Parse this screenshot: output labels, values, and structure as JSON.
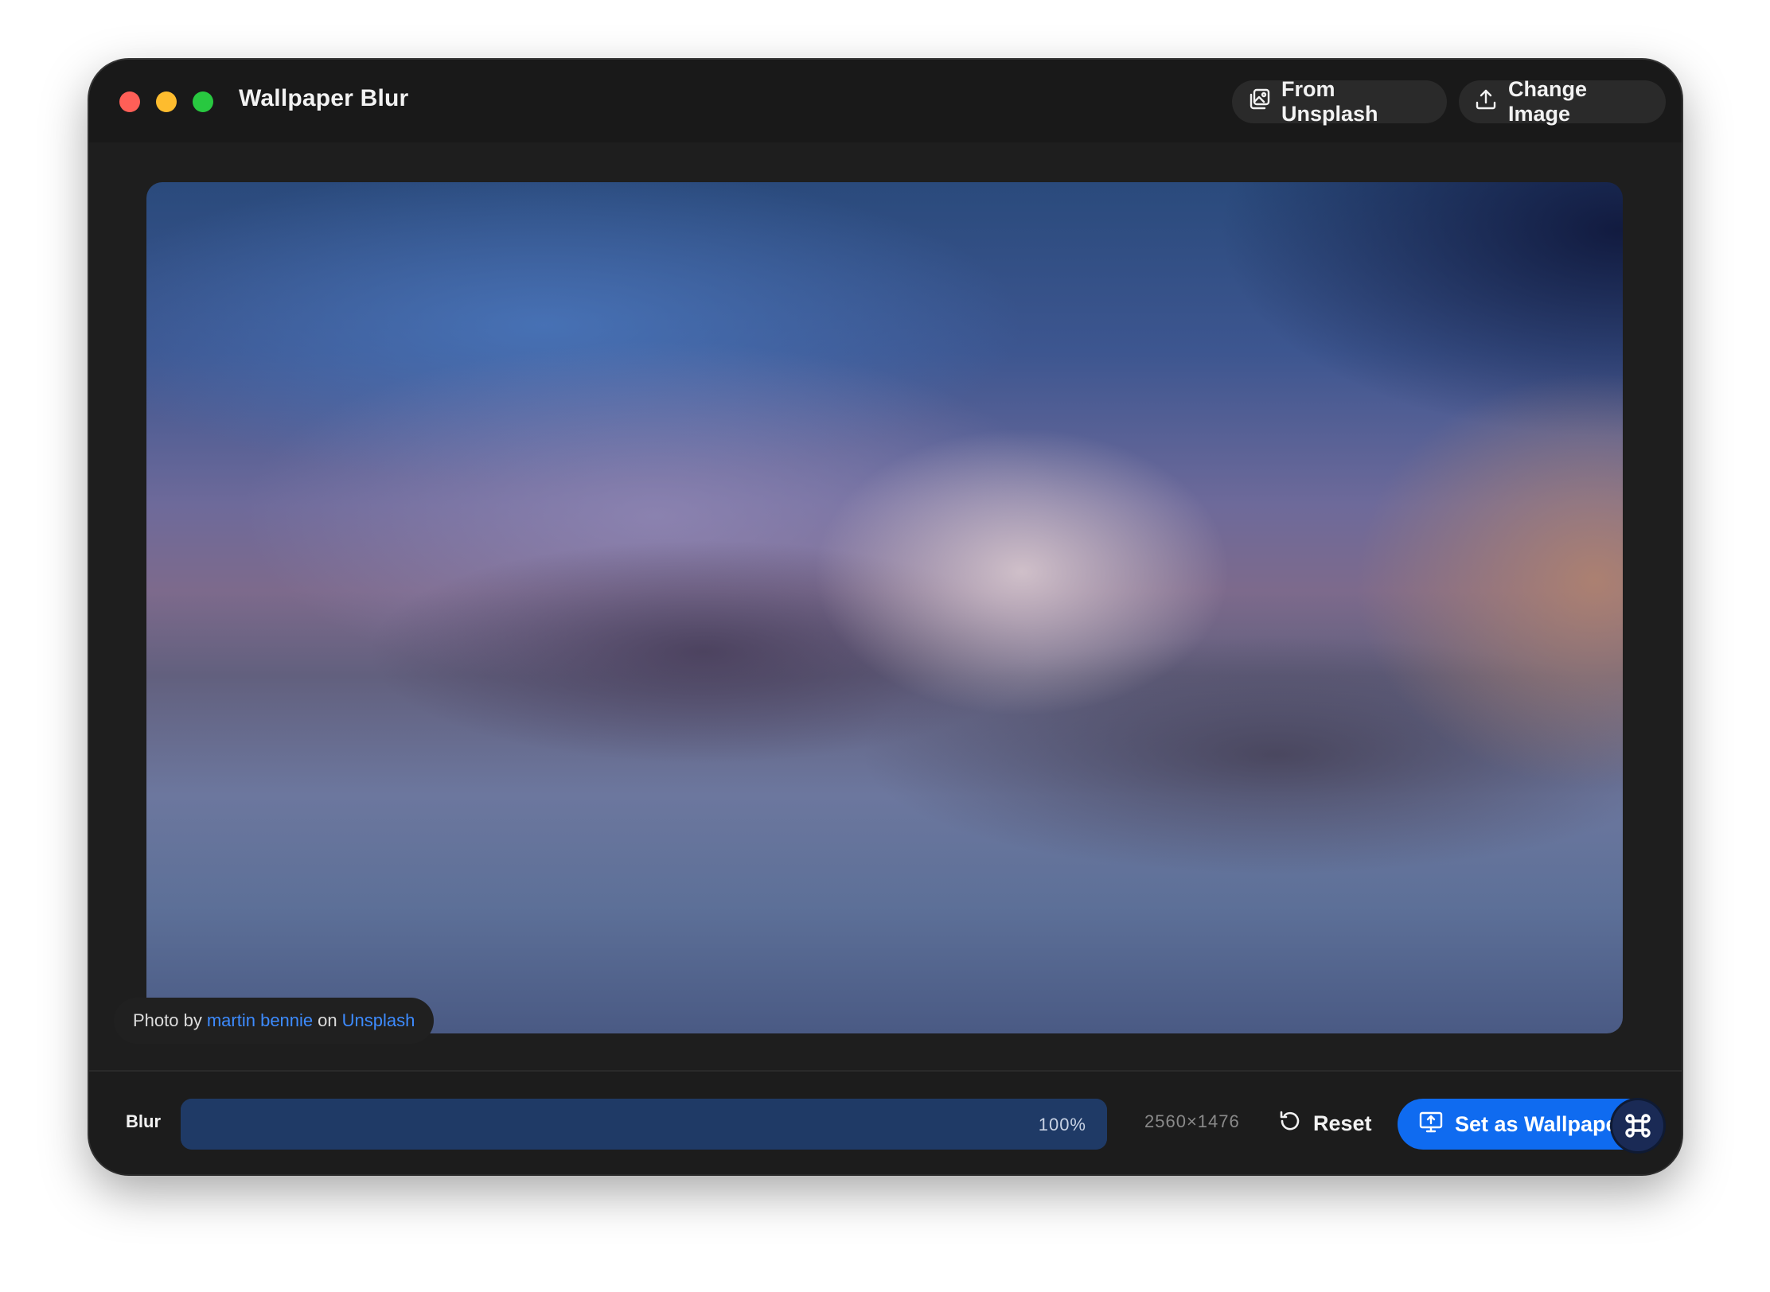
{
  "window": {
    "title": "Wallpaper Blur"
  },
  "toolbar": {
    "from_unsplash_label": "From Unsplash",
    "change_image_label": "Change Image"
  },
  "credit": {
    "prefix": "Photo by",
    "author": "martin bennie",
    "middle": "on",
    "source": "Unsplash"
  },
  "controls": {
    "blur_label": "Blur",
    "blur_value": "100%",
    "blur_fraction": 1.0,
    "resolution": "2560×1476",
    "reset_label": "Reset",
    "set_wallpaper_label": "Set as Wallpaper"
  },
  "icons": {
    "from_unsplash": "images-icon",
    "change_image": "upload-icon",
    "reset": "rotate-ccw-icon",
    "set_wallpaper": "monitor-upload-icon",
    "floating": "command-icon"
  },
  "colors": {
    "accent": "#0f6bf0",
    "link": "#3d8bff",
    "close": "#ff5f57",
    "minimize": "#febc2e",
    "maximize": "#28c840"
  }
}
